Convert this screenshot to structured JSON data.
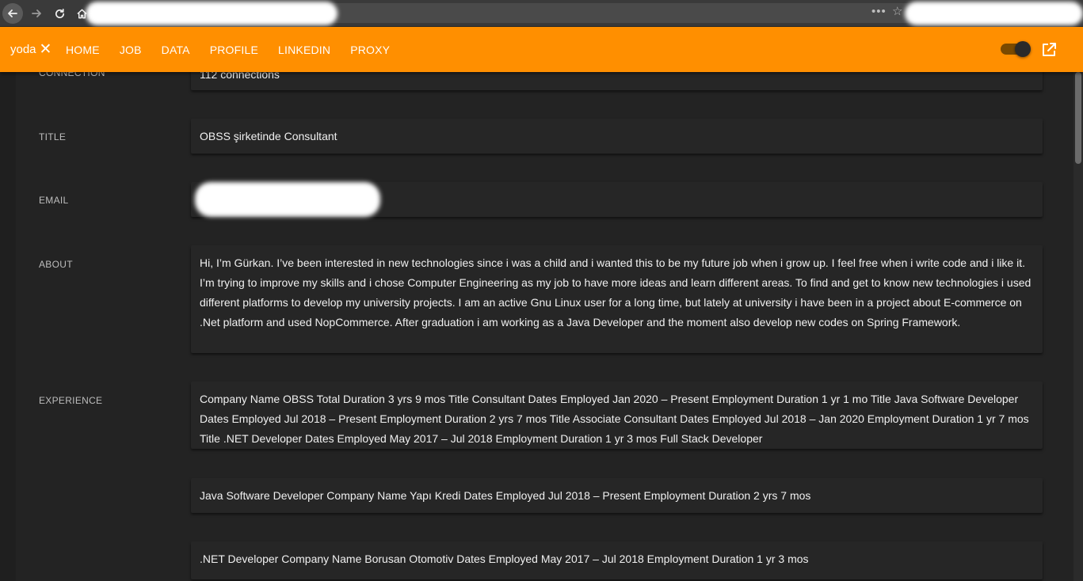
{
  "browser": {
    "back_icon": "arrow-left-icon",
    "forward_icon": "arrow-right-icon",
    "reload_icon": "reload-icon",
    "home_icon": "home-icon",
    "menu_dots": "•••",
    "star": "☆"
  },
  "toolbar": {
    "brand": "yoda",
    "brand_close": "✕",
    "nav": [
      "HOME",
      "JOB",
      "DATA",
      "PROFILE",
      "LINKEDIN",
      "PROXY"
    ],
    "accent_color": "#ff8f00",
    "toggle_on": true
  },
  "profile": {
    "connection": {
      "label": "CONNECTION",
      "value": "112 connections"
    },
    "title": {
      "label": "TITLE",
      "value": "OBSS şirketinde Consultant"
    },
    "email": {
      "label": "EMAIL",
      "value": ""
    },
    "about": {
      "label": "ABOUT",
      "value": "Hi, I’m Gürkan. I’ve been interested in new technologies since i was a child and i wanted this to be my future job when i grow up. I feel free when i write code and i like it. I’m trying to improve my skills and i chose Computer Engineering as my job to have more ideas and learn different areas. To find and get to know new technologies i used different platforms to develop my university projects. I am an active Gnu Linux user for a long time, but lately at university i have been in a project about E-commerce on .Net platform and used NopCommerce. After graduation i am working as a Java Developer and the moment also develop new codes on Spring Framework."
    },
    "experience": {
      "label": "EXPERIENCE",
      "items": [
        "Company Name OBSS Total Duration 3 yrs 9 mos Title Consultant Dates Employed Jan 2020 – Present Employment Duration 1 yr 1 mo Title Java Software Developer Dates Employed Jul 2018 – Present Employment Duration 2 yrs 7 mos Title Associate Consultant Dates Employed Jul 2018 – Jan 2020 Employment Duration 1 yr 7 mos Title .NET Developer Dates Employed May 2017 – Jul 2018 Employment Duration 1 yr 3 mos Full Stack Developer",
        "Java Software Developer Company Name Yapı Kredi Dates Employed Jul 2018 – Present Employment Duration 2 yrs 7 mos",
        ".NET Developer Company Name Borusan Otomotiv Dates Employed May 2017 – Jul 2018 Employment Duration 1 yr 3 mos"
      ]
    }
  }
}
